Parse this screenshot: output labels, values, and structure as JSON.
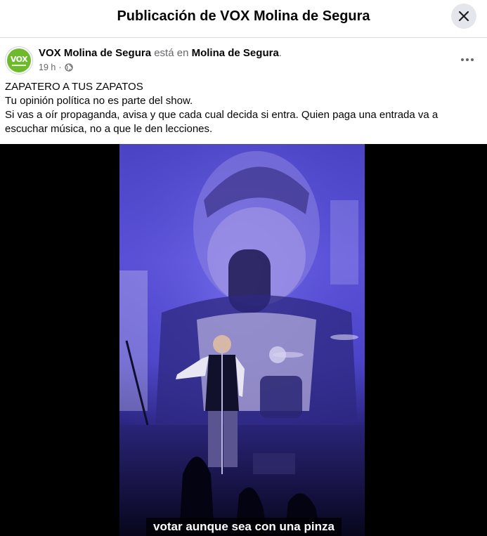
{
  "header": {
    "title": "Publicación de VOX Molina de Segura",
    "close_icon": "close-icon"
  },
  "post": {
    "avatar": {
      "logo_text": "VOX",
      "brand_color": "#6fba2c"
    },
    "author": "VOX Molina de Segura",
    "connector": " está en ",
    "location": "Molina de Segura",
    "location_suffix": ".",
    "time": "19 h",
    "dot": "·",
    "privacy_icon": "globe-icon",
    "more_icon": "more-horizontal-icon",
    "text_lines": [
      "ZAPATERO A TUS ZAPATOS",
      "Tu opinión política no es parte del show.",
      "Si vas a oír propaganda, avisa y que cada cual decida si entra. Quien paga una entrada va a escuchar música, no a que le den lecciones."
    ]
  },
  "video": {
    "description_icon": "concert-video-frame",
    "subtitle": "votar aunque sea con una pinza"
  },
  "colors": {
    "text_primary": "#050505",
    "text_secondary": "#65676b",
    "divider": "#dadde1",
    "button_bg": "#e4e6eb",
    "video_bg": "#000000",
    "stage_light": "#5a50d8"
  }
}
